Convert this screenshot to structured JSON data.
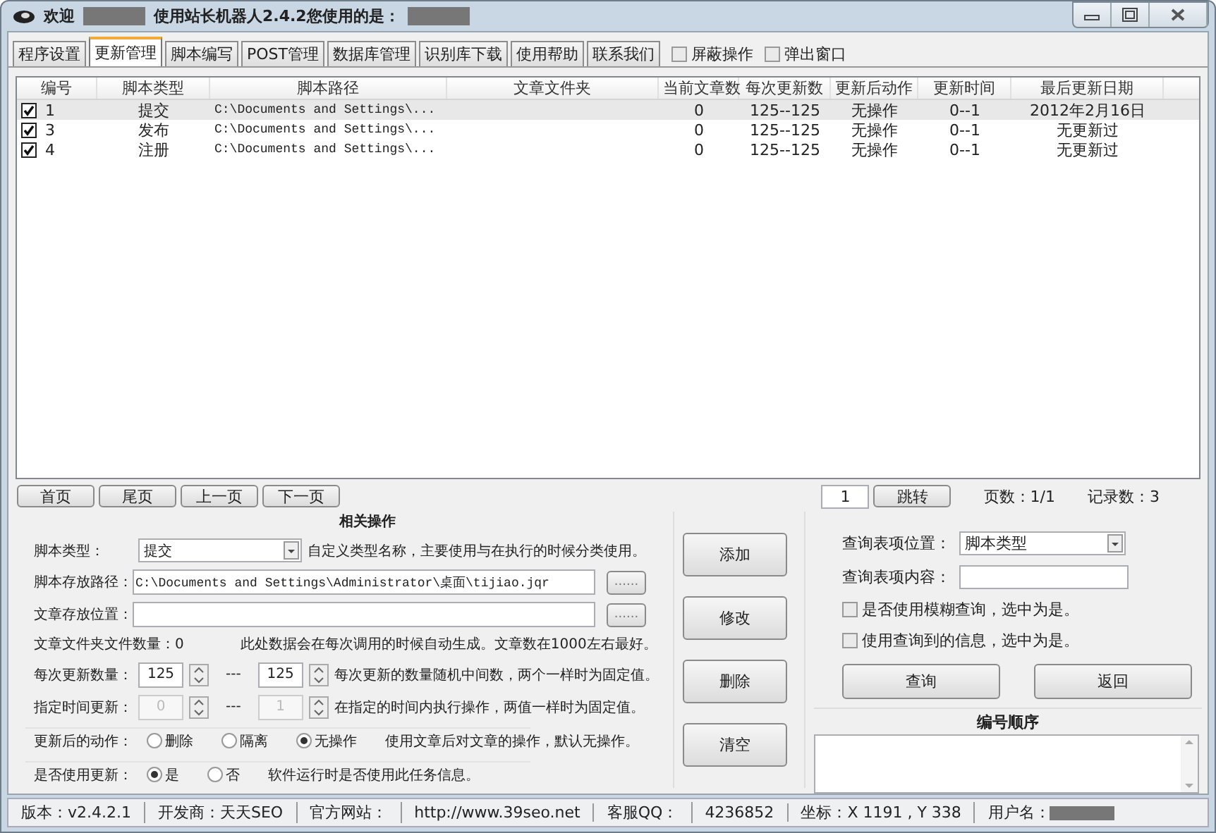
{
  "title_bar": {
    "segments": [
      {
        "kind": "text",
        "text": "欢迎"
      },
      {
        "kind": "redacted"
      },
      {
        "kind": "text",
        "text": "使用站长机器人2.4.2您使用的是："
      },
      {
        "kind": "redacted"
      }
    ]
  },
  "tabs": [
    {
      "label": "程序设置",
      "selected": false
    },
    {
      "label": "更新管理",
      "selected": true
    },
    {
      "label": "脚本编写",
      "selected": false
    },
    {
      "label": "POST管理",
      "selected": false
    },
    {
      "label": "数据库管理",
      "selected": false
    },
    {
      "label": "识别库下载",
      "selected": false
    },
    {
      "label": "使用帮助",
      "selected": false
    },
    {
      "label": "联系我们",
      "selected": false
    }
  ],
  "tab_options": [
    {
      "label": "屏蔽操作",
      "checked": false
    },
    {
      "label": "弹出窗口",
      "checked": false
    }
  ],
  "table": {
    "columns": [
      "编号",
      "脚本类型",
      "脚本路径",
      "文章文件夹",
      "当前文章数",
      "每次更新数",
      "更新后动作",
      "更新时间",
      "最后更新日期"
    ],
    "rows": [
      {
        "checked": true,
        "selected": true,
        "cells": [
          "1",
          "提交",
          "C:\\Documents and Settings\\...",
          "",
          "0",
          "125--125",
          "无操作",
          "0--1",
          "2012年2月16日"
        ]
      },
      {
        "checked": true,
        "selected": false,
        "cells": [
          "3",
          "发布",
          "C:\\Documents and Settings\\...",
          "",
          "0",
          "125--125",
          "无操作",
          "0--1",
          "无更新过"
        ]
      },
      {
        "checked": true,
        "selected": false,
        "cells": [
          "4",
          "注册",
          "C:\\Documents and Settings\\...",
          "",
          "0",
          "125--125",
          "无操作",
          "0--1",
          "无更新过"
        ]
      }
    ]
  },
  "pager": {
    "buttons": [
      "首页",
      "尾页",
      "上一页",
      "下一页"
    ],
    "page_input": "1",
    "jump": "跳转",
    "pages": "页数：1/1",
    "records": "记录数：3"
  },
  "form": {
    "title": "相关操作",
    "script_type": {
      "label": "脚本类型：",
      "value": "提交",
      "hint": "自定义类型名称，主要使用与在执行的时候分类使用。"
    },
    "script_path": {
      "label": "脚本存放路径：",
      "value": "C:\\Documents and Settings\\Administrator\\桌面\\tijiao.jqr",
      "browse": "......"
    },
    "article_path": {
      "label": "文章存放位置：",
      "browse": "......"
    },
    "folder_count": {
      "label": "文章文件夹文件数量：0",
      "hint": "此处数据会在每次调用的时候自动生成。文章数在1000左右最好。"
    },
    "ranges": [
      {
        "label": "每次更新数量：",
        "from": "125",
        "separator": "---",
        "to": "125",
        "hint": "每次更新的数量随机中间数，两个一样时为固定值。",
        "disabled": false
      },
      {
        "label": "指定时间更新：",
        "from": "0",
        "separator": "---",
        "to": "1",
        "hint": "在指定的时间内执行操作，两值一样时为固定值。",
        "disabled": true
      }
    ],
    "radio_groups": [
      {
        "label": "更新后的动作：",
        "options": [
          {
            "label": "删除",
            "selected": false
          },
          {
            "label": "隔离",
            "selected": false
          },
          {
            "label": "无操作",
            "selected": true
          }
        ],
        "hint": "使用文章后对文章的操作，默认无操作。"
      },
      {
        "label": "是否使用更新：",
        "options": [
          {
            "label": "是",
            "selected": true
          },
          {
            "label": "否",
            "selected": false
          }
        ],
        "hint": "软件运行时是否使用此任务信息。"
      }
    ]
  },
  "actions": [
    "添加",
    "修改",
    "删除",
    "清空"
  ],
  "query": {
    "position_label": "查询表项位置：",
    "position_value": "脚本类型",
    "content_label": "查询表项内容：",
    "checkboxes": [
      {
        "label": "是否使用模糊查询，选中为是。",
        "checked": false
      },
      {
        "label": "使用查询到的信息，选中为是。",
        "checked": false
      }
    ],
    "buttons": [
      "查询",
      "返回"
    ],
    "order_title": "编号顺序"
  },
  "status_bar": [
    {
      "kind": "text",
      "text": "版本：v2.4.2.1"
    },
    {
      "kind": "text",
      "text": "开发商：天天SEO"
    },
    {
      "kind": "text",
      "text": "官方网站："
    },
    {
      "kind": "text",
      "text": "http://www.39seo.net"
    },
    {
      "kind": "text",
      "text": "客服QQ："
    },
    {
      "kind": "text",
      "text": "4236852"
    },
    {
      "kind": "text",
      "text": "坐标：X 1191 , Y 338"
    },
    {
      "kind": "label_redacted",
      "text": "用户名："
    }
  ]
}
